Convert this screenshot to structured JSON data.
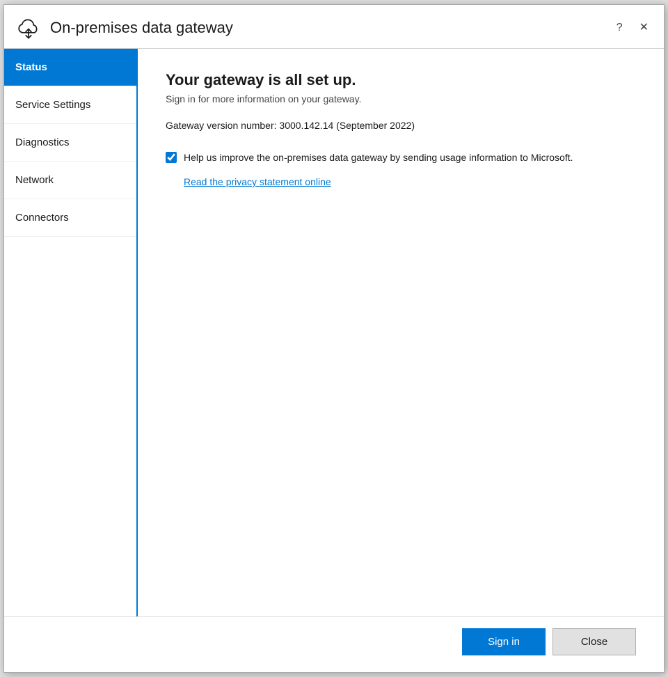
{
  "titleBar": {
    "title": "On-premises data gateway",
    "helpBtn": "?",
    "closeBtn": "✕"
  },
  "sidebar": {
    "items": [
      {
        "id": "status",
        "label": "Status",
        "active": true
      },
      {
        "id": "service-settings",
        "label": "Service Settings",
        "active": false
      },
      {
        "id": "diagnostics",
        "label": "Diagnostics",
        "active": false
      },
      {
        "id": "network",
        "label": "Network",
        "active": false
      },
      {
        "id": "connectors",
        "label": "Connectors",
        "active": false
      }
    ]
  },
  "main": {
    "heading": "Your gateway is all set up.",
    "subtitle": "Sign in for more information on your gateway.",
    "versionText": "Gateway version number: 3000.142.14 (September 2022)",
    "checkboxLabel": "Help us improve the on-premises data gateway by sending usage information to Microsoft.",
    "privacyLink": "Read the privacy statement online",
    "checkboxChecked": true
  },
  "footer": {
    "signinLabel": "Sign in",
    "closeLabel": "Close"
  }
}
